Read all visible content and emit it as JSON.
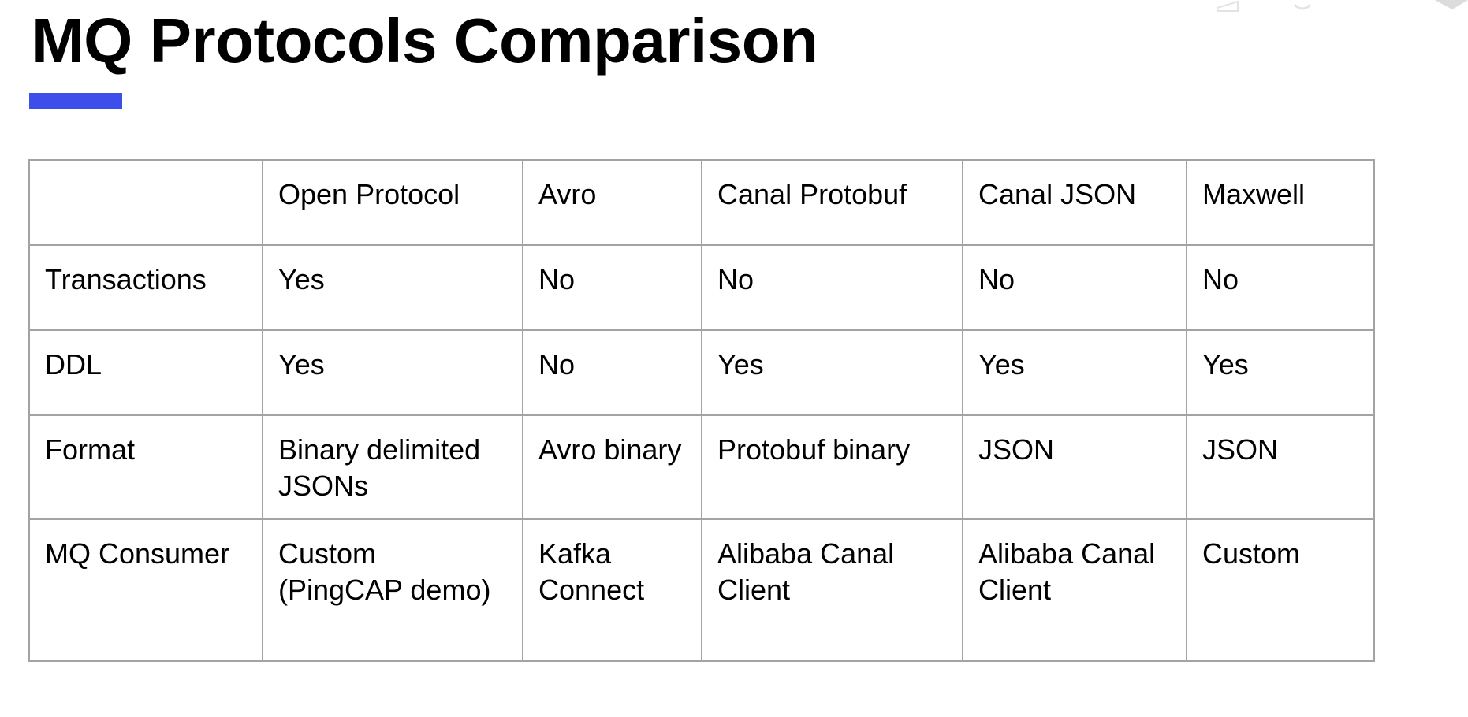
{
  "slide": {
    "title": "MQ Protocols Comparison",
    "accent_color": "#3d4fea"
  },
  "table": {
    "columns": [
      "",
      "Open Protocol",
      "Avro",
      "Canal Protobuf",
      "Canal JSON",
      "Maxwell"
    ],
    "rows": [
      {
        "label": "Transactions",
        "cells": [
          "Yes",
          "No",
          "No",
          "No",
          "No"
        ]
      },
      {
        "label": "DDL",
        "cells": [
          "Yes",
          "No",
          "Yes",
          "Yes",
          "Yes"
        ]
      },
      {
        "label": "Format",
        "cells": [
          "Binary delimited JSONs",
          "Avro binary",
          "Protobuf binary",
          "JSON",
          "JSON"
        ]
      },
      {
        "label": "MQ Consumer",
        "cells": [
          "Custom (PingCAP demo)",
          "Kafka Connect",
          "Alibaba Canal Client",
          "Alibaba Canal Client",
          "Custom"
        ]
      }
    ]
  }
}
